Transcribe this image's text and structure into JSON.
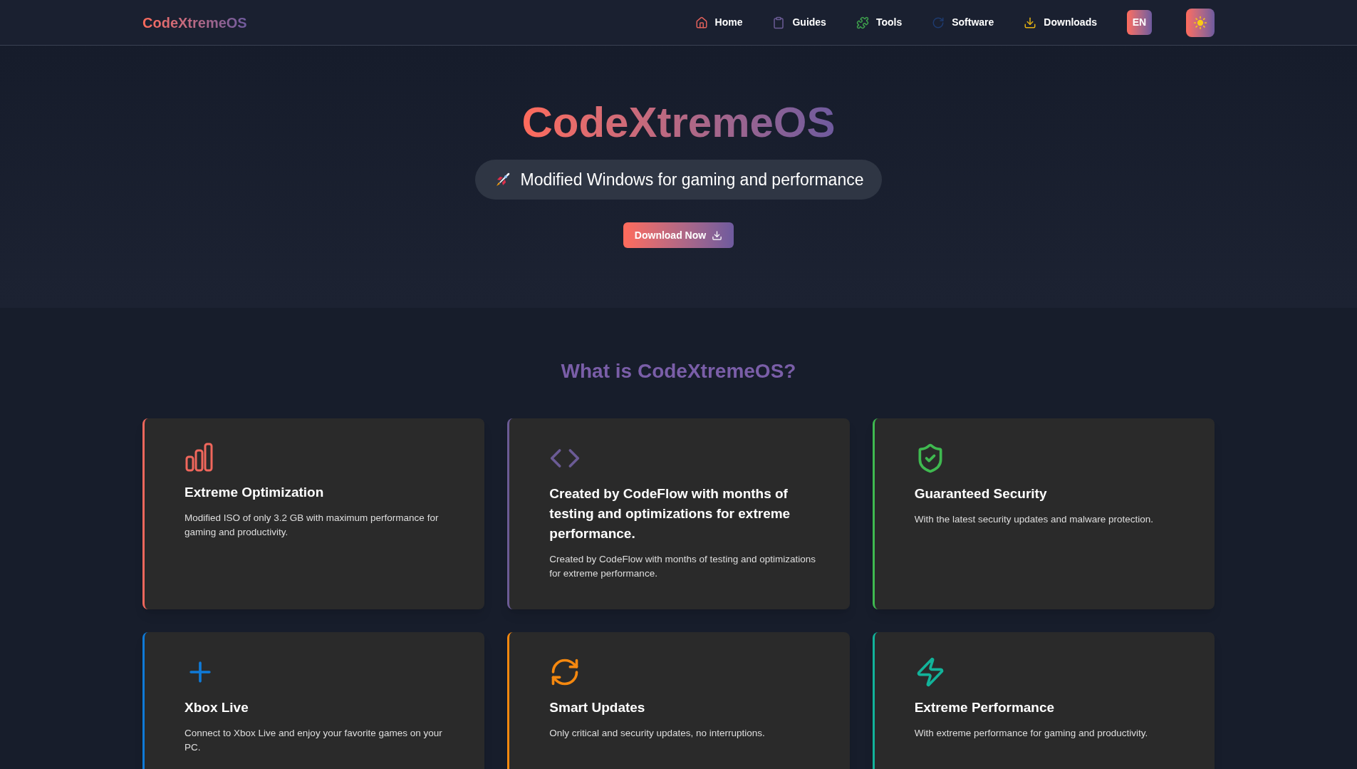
{
  "nav": {
    "logo": "CodeXtremeOS",
    "items": [
      {
        "label": "Home",
        "color": "#e0605a"
      },
      {
        "label": "Guides",
        "color": "#6b5b95"
      },
      {
        "label": "Tools",
        "color": "#3fa34d"
      },
      {
        "label": "Software",
        "color": "#1e3a6e"
      },
      {
        "label": "Downloads",
        "color": "#e2b013"
      }
    ],
    "language": "EN"
  },
  "hero": {
    "title": "CodeXtremeOS",
    "tagline": "Modified Windows for gaming and performance",
    "button": "Download Now"
  },
  "features": {
    "heading": "What is CodeXtremeOS?",
    "cards": [
      {
        "title": "Extreme Optimization",
        "text": "Modified ISO of only 3.2 GB with maximum performance for gaming and productivity.",
        "color": "#f0675c"
      },
      {
        "title": "Created by CodeFlow with months of testing and optimizations for extreme performance.",
        "text": "Created by CodeFlow with months of testing and optimizations for extreme performance.",
        "color": "#6b5b95"
      },
      {
        "title": "Guaranteed Security",
        "text": "With the latest security updates and malware protection.",
        "color": "#3fb950"
      },
      {
        "title": "Xbox Live",
        "text": "Connect to Xbox Live and enjoy your favorite games on your PC.",
        "color": "#0f7ad8"
      },
      {
        "title": "Smart Updates",
        "text": "Only critical and security updates, no interruptions.",
        "color": "#f5880f"
      },
      {
        "title": "Extreme Performance",
        "text": "With extreme performance for gaming and productivity.",
        "color": "#12b39a"
      }
    ]
  }
}
